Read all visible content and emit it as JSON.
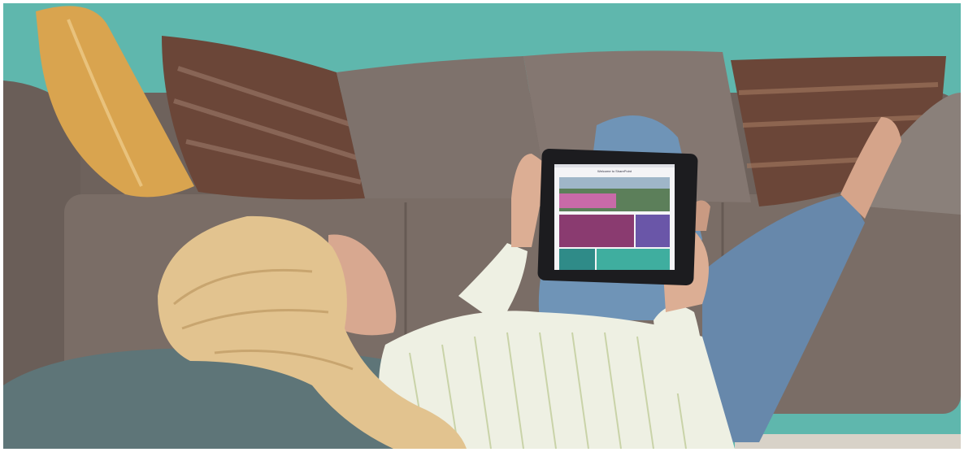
{
  "photo": {
    "subject": "woman-lying-on-floor-using-tablet",
    "colors": {
      "wall": "#5fb7ad",
      "sofa": "#7a6d66",
      "hair": "#e2c38f",
      "shirt": "#eef0e3",
      "jeans": "#6f94b7",
      "floor_pillow": "#5e7578",
      "mustard_pillow": "#d9a44f",
      "patterned_pillow": "#6b4638"
    }
  },
  "tablet_screen": {
    "title": "Welcome to SharePoint",
    "colors": {
      "magenta_tile": "#8a3b70",
      "purple_tile": "#6a56a8",
      "teal_tile": "#2f8b88",
      "green_tile": "#3fae9f"
    }
  }
}
